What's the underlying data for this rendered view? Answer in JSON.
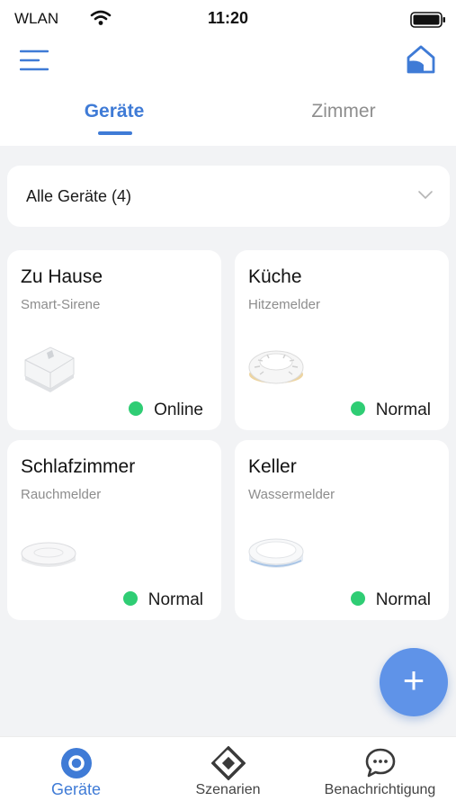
{
  "status_bar": {
    "carrier": "WLAN",
    "time": "11:20",
    "wifi_icon": "wifi-icon",
    "battery_icon": "battery-icon"
  },
  "header": {
    "menu_icon": "menu-icon",
    "home_icon": "home-icon",
    "tabs": [
      {
        "label": "Geräte",
        "active": true
      },
      {
        "label": "Zimmer",
        "active": false
      }
    ]
  },
  "filter": {
    "selected": "Alle Geräte (4)",
    "chevron_icon": "chevron-down-icon"
  },
  "devices": [
    {
      "room": "Zu Hause",
      "type": "Smart-Sirene",
      "status": "Online",
      "image": "smart-siren-image"
    },
    {
      "room": "Küche",
      "type": "Hitzemelder",
      "status": "Normal",
      "image": "heat-detector-image"
    },
    {
      "room": "Schlafzimmer",
      "type": "Rauchmelder",
      "status": "Normal",
      "image": "smoke-detector-image"
    },
    {
      "room": "Keller",
      "type": "Wassermelder",
      "status": "Normal",
      "image": "water-detector-image"
    }
  ],
  "fab": {
    "label": "+"
  },
  "bottom_nav": [
    {
      "label": "Geräte",
      "icon": "devices-icon",
      "active": true
    },
    {
      "label": "Szenarien",
      "icon": "scenes-icon",
      "active": false
    },
    {
      "label": "Benachrichtigung",
      "icon": "chat-bubble-icon",
      "active": false
    }
  ],
  "colors": {
    "accent": "#3f7bd6",
    "status_ok": "#2fcd74",
    "fab": "#5f93e8",
    "background": "#f2f3f5"
  }
}
